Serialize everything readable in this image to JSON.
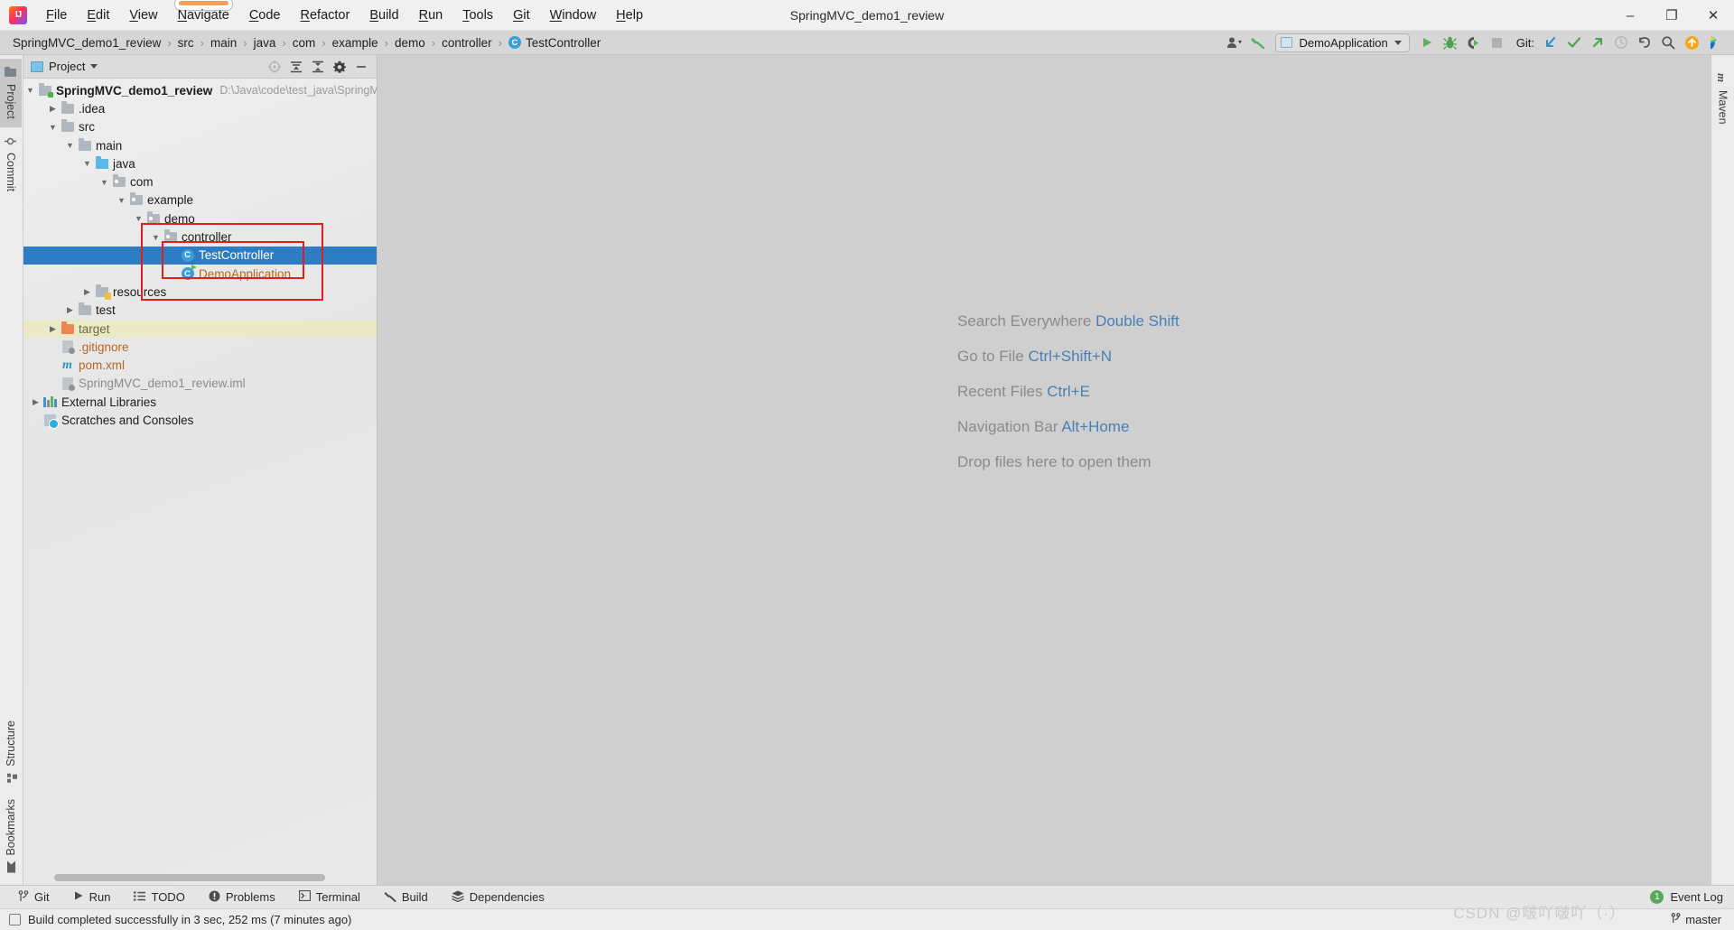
{
  "window": {
    "title": "SpringMVC_demo1_review",
    "minimize_label": "–",
    "maximize_label": "❐",
    "close_label": "✕"
  },
  "menu": {
    "items": [
      {
        "label": "File",
        "mnemonic": "F",
        "active": false
      },
      {
        "label": "Edit",
        "mnemonic": "E",
        "active": false
      },
      {
        "label": "View",
        "mnemonic": "V",
        "active": false
      },
      {
        "label": "Navigate",
        "mnemonic": "N",
        "active": true
      },
      {
        "label": "Code",
        "mnemonic": "C",
        "active": false
      },
      {
        "label": "Refactor",
        "mnemonic": "R",
        "active": false
      },
      {
        "label": "Build",
        "mnemonic": "B",
        "active": false
      },
      {
        "label": "Run",
        "mnemonic": "R",
        "active": false
      },
      {
        "label": "Tools",
        "mnemonic": "T",
        "active": false
      },
      {
        "label": "Git",
        "mnemonic": "G",
        "active": false
      },
      {
        "label": "Window",
        "mnemonic": "W",
        "active": false
      },
      {
        "label": "Help",
        "mnemonic": "H",
        "active": false
      }
    ]
  },
  "navbar": {
    "breadcrumbs": [
      "SpringMVC_demo1_review",
      "src",
      "main",
      "java",
      "com",
      "example",
      "demo",
      "controller"
    ],
    "separator": "›",
    "current_class": "TestController",
    "class_icon_letter": "C"
  },
  "toolbar": {
    "run_configuration": "DemoApplication",
    "git_label": "Git:",
    "icons": [
      {
        "name": "profiler-icon",
        "glyph": ""
      },
      {
        "name": "build-hammer-icon",
        "glyph": ""
      },
      {
        "name": "run-icon",
        "glyph": ""
      },
      {
        "name": "debug-icon",
        "glyph": ""
      },
      {
        "name": "run-with-coverage-icon",
        "glyph": ""
      },
      {
        "name": "stop-icon",
        "glyph": ""
      },
      {
        "name": "git-update-icon",
        "glyph": ""
      },
      {
        "name": "git-commit-icon",
        "glyph": ""
      },
      {
        "name": "git-push-icon",
        "glyph": ""
      },
      {
        "name": "git-history-icon",
        "glyph": ""
      },
      {
        "name": "git-rollback-icon",
        "glyph": ""
      },
      {
        "name": "search-icon",
        "glyph": ""
      },
      {
        "name": "update-available-icon",
        "glyph": ""
      },
      {
        "name": "ide-feature-icon",
        "glyph": ""
      }
    ]
  },
  "left_tabs": {
    "top": [
      {
        "label": "Project",
        "selected": true
      },
      {
        "label": "Commit",
        "selected": false
      }
    ],
    "bottom": [
      {
        "label": "Structure",
        "selected": false
      },
      {
        "label": "Bookmarks",
        "selected": false
      }
    ]
  },
  "right_tabs": [
    {
      "label": "Maven",
      "selected": false
    }
  ],
  "project_panel": {
    "title": "Project",
    "tools": [
      {
        "name": "select-opened-file-icon"
      },
      {
        "name": "expand-all-icon"
      },
      {
        "name": "collapse-all-icon"
      },
      {
        "name": "settings-gear-icon"
      },
      {
        "name": "hide-panel-icon"
      }
    ],
    "tree": [
      {
        "label": "SpringMVC_demo1_review",
        "hint": "D:\\Java\\code\\test_java\\SpringM",
        "indent": 0,
        "arrow": "down",
        "icon": "project-folder",
        "style": "bold"
      },
      {
        "label": ".idea",
        "indent": 1,
        "arrow": "right",
        "icon": "folder-gray"
      },
      {
        "label": "src",
        "indent": 1,
        "arrow": "down",
        "icon": "folder-gray"
      },
      {
        "label": "main",
        "indent": 2,
        "arrow": "down",
        "icon": "folder-gray"
      },
      {
        "label": "java",
        "indent": 3,
        "arrow": "down",
        "icon": "folder-source-blue"
      },
      {
        "label": "com",
        "indent": 4,
        "arrow": "down",
        "icon": "folder-package"
      },
      {
        "label": "example",
        "indent": 5,
        "arrow": "down",
        "icon": "folder-package"
      },
      {
        "label": "demo",
        "indent": 6,
        "arrow": "down",
        "icon": "folder-package"
      },
      {
        "label": "controller",
        "indent": 7,
        "arrow": "down",
        "icon": "folder-package"
      },
      {
        "label": "TestController",
        "indent": 8,
        "arrow": "none",
        "icon": "java-class",
        "selected": true
      },
      {
        "label": "DemoApplication",
        "indent": 8,
        "arrow": "none",
        "icon": "java-class-runnable",
        "style": "orange"
      },
      {
        "label": "resources",
        "indent": 3,
        "arrow": "right",
        "icon": "folder-resources"
      },
      {
        "label": "test",
        "indent": 2,
        "arrow": "right",
        "icon": "folder-gray"
      },
      {
        "label": "target",
        "indent": 1,
        "arrow": "right",
        "icon": "folder-orange",
        "excluded": true,
        "style": "olive"
      },
      {
        "label": ".gitignore",
        "indent": 1,
        "arrow": "none",
        "icon": "file-ignored",
        "style": "orange"
      },
      {
        "label": "pom.xml",
        "indent": 1,
        "arrow": "none",
        "icon": "maven-file",
        "style": "orange"
      },
      {
        "label": "SpringMVC_demo1_review.iml",
        "indent": 1,
        "arrow": "none",
        "icon": "file-ignored",
        "style": "gray"
      },
      {
        "label": "External Libraries",
        "indent": 0,
        "arrow": "right",
        "icon": "libraries"
      },
      {
        "label": "Scratches and Consoles",
        "indent": 0,
        "arrow": "none",
        "icon": "scratches"
      }
    ]
  },
  "editor": {
    "tips": [
      {
        "text": "Search Everywhere",
        "key": "Double Shift"
      },
      {
        "text": "Go to File",
        "key": "Ctrl+Shift+N"
      },
      {
        "text": "Recent Files",
        "key": "Ctrl+E"
      },
      {
        "text": "Navigation Bar",
        "key": "Alt+Home"
      },
      {
        "text": "Drop files here to open them",
        "key": ""
      }
    ]
  },
  "bottom_bar": {
    "items": [
      {
        "label": "Git",
        "icon": "git-branch-icon"
      },
      {
        "label": "Run",
        "icon": "run-icon"
      },
      {
        "label": "TODO",
        "icon": "todo-list-icon"
      },
      {
        "label": "Problems",
        "icon": "problems-icon"
      },
      {
        "label": "Terminal",
        "icon": "terminal-icon"
      },
      {
        "label": "Build",
        "icon": "build-hammer-icon"
      },
      {
        "label": "Dependencies",
        "icon": "dependencies-icon"
      }
    ],
    "event_log": {
      "label": "Event Log",
      "count": "1"
    }
  },
  "status_bar": {
    "message": "Build completed successfully in 3 sec, 252 ms (7 minutes ago)",
    "branch": "master",
    "watermark": "CSDN @啵吖啵吖（·）"
  },
  "colors": {
    "selection_blue": "#2d7cc4",
    "annotation_red": "#e02020",
    "link_blue": "#4a7fb5",
    "excluded_yellow": "#eae9c8"
  }
}
